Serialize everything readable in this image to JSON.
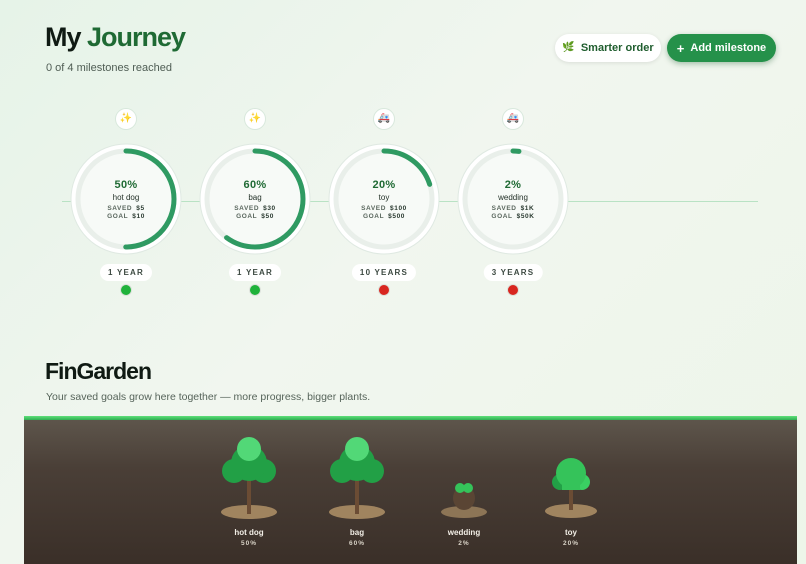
{
  "header": {
    "title_part1": "My",
    "title_part2": "Journey",
    "subtitle": "0 of 4 milestones reached"
  },
  "actions": {
    "smarter_order": {
      "label": "Smarter order",
      "icon": "sparkle-leaf-icon"
    },
    "add_milestone": {
      "label": "Add milestone",
      "icon": "plus-icon"
    }
  },
  "milestones": [
    {
      "badge": "✨",
      "badge_icon": "sparkles-icon",
      "percent": "50%",
      "progress": 0.5,
      "name": "hot dog",
      "saved_label": "SAVED",
      "saved": "$5",
      "goal_label": "GOAL",
      "goal": "$10",
      "duration": "1 YEAR",
      "status": "green"
    },
    {
      "badge": "✨",
      "badge_icon": "sparkles-icon",
      "percent": "60%",
      "progress": 0.6,
      "name": "bag",
      "saved_label": "SAVED",
      "saved": "$30",
      "goal_label": "GOAL",
      "goal": "$50",
      "duration": "1 YEAR",
      "status": "green"
    },
    {
      "badge": "🚑",
      "badge_icon": "ambulance-icon",
      "percent": "20%",
      "progress": 0.2,
      "name": "toy",
      "saved_label": "SAVED",
      "saved": "$100",
      "goal_label": "GOAL",
      "goal": "$500",
      "duration": "10 YEARS",
      "status": "red"
    },
    {
      "badge": "🚑",
      "badge_icon": "ambulance-icon",
      "percent": "2%",
      "progress": 0.02,
      "name": "wedding",
      "saved_label": "SAVED",
      "saved": "$1K",
      "goal_label": "GOAL",
      "goal": "$50K",
      "duration": "3 YEARS",
      "status": "red"
    }
  ],
  "garden": {
    "title": "FinGarden",
    "subtitle": "Your saved goals grow here together — more progress, bigger plants.",
    "plants": [
      {
        "name": "hot dog",
        "percent": "50%",
        "stage": "tree"
      },
      {
        "name": "bag",
        "percent": "60%",
        "stage": "tree"
      },
      {
        "name": "wedding",
        "percent": "2%",
        "stage": "seed"
      },
      {
        "name": "toy",
        "percent": "20%",
        "stage": "bush"
      }
    ]
  },
  "colors": {
    "brand": "#25914a",
    "ring": "#2f9a62",
    "dot_green": "#1fb23a",
    "dot_red": "#d8261f",
    "leaf": "#35c35a",
    "leaf_dark": "#22a046",
    "trunk": "#6b4c34"
  }
}
